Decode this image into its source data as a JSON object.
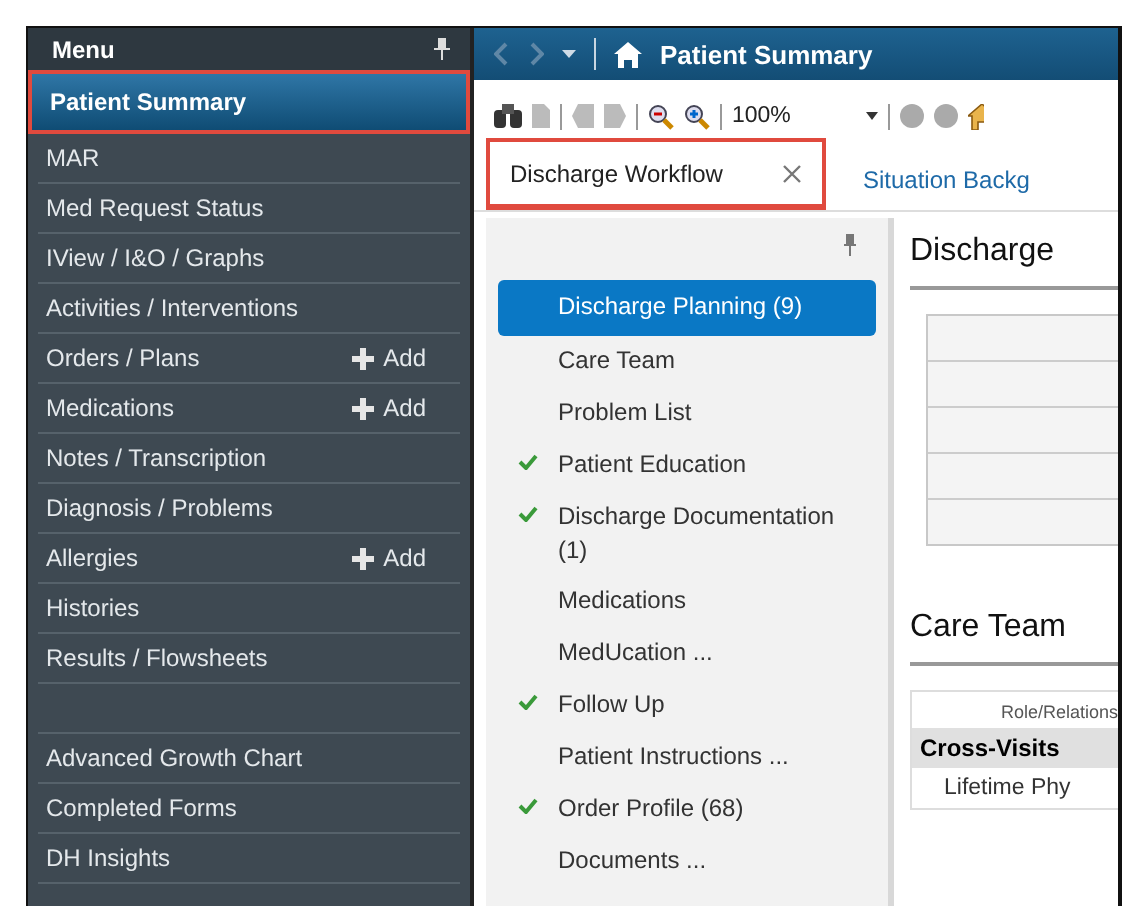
{
  "menu": {
    "title": "Menu",
    "items": [
      {
        "kind": "link",
        "label": "Patient Summary",
        "selected": true,
        "highlighted": true
      },
      {
        "kind": "link",
        "label": "MAR",
        "selected": false,
        "highlighted": false
      },
      {
        "kind": "link",
        "label": "Med Request Status",
        "selected": false,
        "highlighted": false
      },
      {
        "kind": "link",
        "label": "IView / I&O / Graphs",
        "selected": false,
        "highlighted": false
      },
      {
        "kind": "link",
        "label": "Activities / Interventions",
        "selected": false,
        "highlighted": false
      },
      {
        "kind": "link",
        "label": "Orders / Plans",
        "add": "Add",
        "selected": false,
        "highlighted": false
      },
      {
        "kind": "link",
        "label": "Medications",
        "add": "Add",
        "selected": false,
        "highlighted": false
      },
      {
        "kind": "link",
        "label": "Notes / Transcription",
        "selected": false,
        "highlighted": false
      },
      {
        "kind": "link",
        "label": "Diagnosis / Problems",
        "selected": false,
        "highlighted": false
      },
      {
        "kind": "link",
        "label": "Allergies",
        "add": "Add",
        "selected": false,
        "highlighted": false
      },
      {
        "kind": "link",
        "label": "Histories",
        "selected": false,
        "highlighted": false
      },
      {
        "kind": "link",
        "label": "Results / Flowsheets",
        "selected": false,
        "highlighted": false
      },
      {
        "kind": "spacer"
      },
      {
        "kind": "link",
        "label": "Advanced Growth Chart",
        "selected": false,
        "highlighted": false
      },
      {
        "kind": "link",
        "label": "Completed Forms",
        "selected": false,
        "highlighted": false
      },
      {
        "kind": "link",
        "label": "DH Insights",
        "selected": false,
        "highlighted": false
      }
    ]
  },
  "title_bar": {
    "title": "Patient Summary"
  },
  "toolbar": {
    "zoom": "100%"
  },
  "tabs": [
    {
      "label": "Discharge Workflow",
      "selected": true,
      "highlighted": true,
      "closable": true
    },
    {
      "label": "Situation Backg",
      "selected": false,
      "highlighted": false,
      "closable": false
    }
  ],
  "workflow": [
    {
      "label": "Discharge Planning (9)",
      "selected": true,
      "done": false
    },
    {
      "label": "Care Team",
      "selected": false,
      "done": false
    },
    {
      "label": "Problem List",
      "selected": false,
      "done": false
    },
    {
      "label": "Patient Education",
      "selected": false,
      "done": true
    },
    {
      "label": "Discharge Documentation (1)",
      "selected": false,
      "done": true
    },
    {
      "label": "Medications",
      "selected": false,
      "done": false
    },
    {
      "label": "MedUcation ...",
      "selected": false,
      "done": false
    },
    {
      "label": "Follow Up",
      "selected": false,
      "done": true
    },
    {
      "label": "Patient Instructions ...",
      "selected": false,
      "done": false
    },
    {
      "label": "Order Profile (68)",
      "selected": false,
      "done": true
    },
    {
      "label": "Documents ...",
      "selected": false,
      "done": false
    }
  ],
  "content": {
    "sections": [
      {
        "heading": "Discharge",
        "kind": "empty_table"
      },
      {
        "heading": "Care Team",
        "kind": "table",
        "header": "Role/Relations",
        "group": "Cross-Visits",
        "rows": [
          "Lifetime Phy"
        ]
      }
    ]
  }
}
